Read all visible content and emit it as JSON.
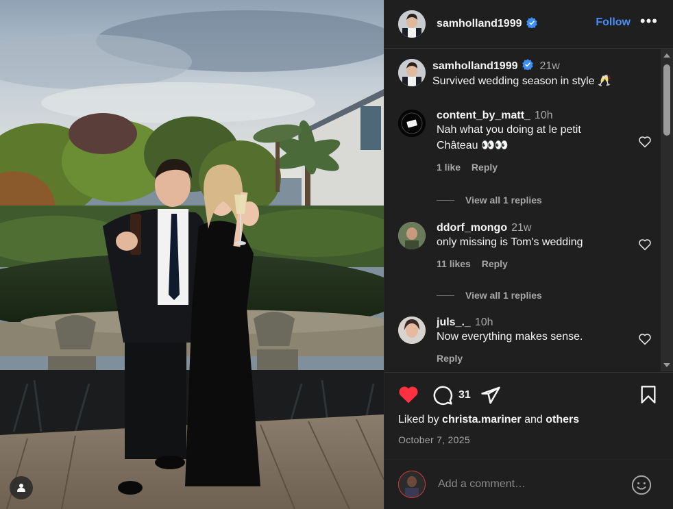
{
  "post": {
    "author": "samholland1999",
    "follow_label": "Follow",
    "more_label": "•••"
  },
  "caption": {
    "username": "samholland1999",
    "time": "21w",
    "text": "Survived wedding season in style 🥂"
  },
  "comments": [
    {
      "username": "content_by_matt_",
      "time": "10h",
      "text": "Nah what you doing at le petit Château 👀👀",
      "likes": "1 like",
      "reply": "Reply",
      "view_replies": "View all 1 replies"
    },
    {
      "username": "ddorf_mongo",
      "time": "21w",
      "text": "only missing is Tom's wedding",
      "likes": "11 likes",
      "reply": "Reply",
      "view_replies": "View all 1 replies"
    },
    {
      "username": "juls_._",
      "time": "10h",
      "text": "Now everything makes sense.",
      "reply": "Reply"
    }
  ],
  "actions": {
    "comment_count": "31",
    "liked_prefix": "Liked by ",
    "liked_user": "christa.mariner",
    "liked_mid": " and ",
    "liked_others": "others",
    "date": "October 7, 2025"
  },
  "add_comment": {
    "placeholder": "Add a comment…"
  },
  "colors": {
    "accent": "#4a8cf7",
    "like_red": "#ff3040",
    "panel_bg": "#1f1f1f"
  }
}
